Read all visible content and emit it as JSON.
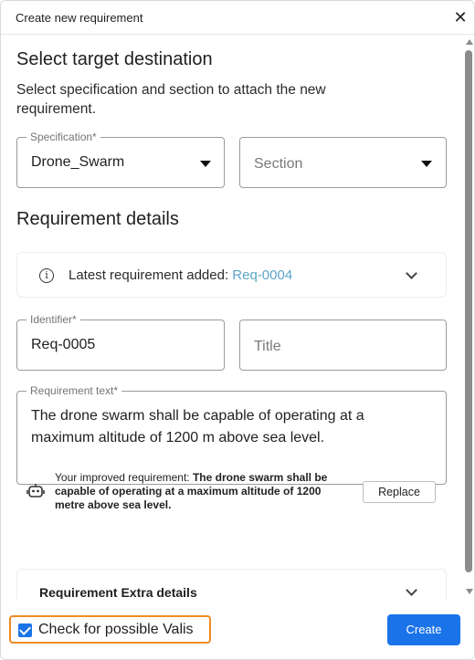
{
  "dialog": {
    "title": "Create new requirement",
    "close_glyph": "✕"
  },
  "target": {
    "heading": "Select target destination",
    "subtitle": "Select specification and section to attach the new requirement.",
    "specification": {
      "label": "Specification*",
      "value": "Drone_Swarm"
    },
    "section": {
      "placeholder": "Section"
    }
  },
  "details": {
    "heading": "Requirement details",
    "latest": {
      "label": "Latest requirement added: ",
      "link": "Req-0004"
    },
    "identifier": {
      "label": "Identifier*",
      "value": "Req-0005"
    },
    "title": {
      "placeholder": "Title"
    },
    "requirement_text": {
      "label": "Requirement text*",
      "value": "The drone swarm shall be capable of operating at a maximum altitude of 1200 m above sea level."
    },
    "improved": {
      "prefix": "Your improved requirement: ",
      "text": "The drone swarm shall be capable of operating at a maximum altitude of 1200 metre above sea level.",
      "replace_label": "Replace"
    },
    "extra": {
      "title": "Requirement Extra details"
    }
  },
  "footer": {
    "checkbox_label": "Check for possible Valis",
    "checkbox_checked": true,
    "create_label": "Create"
  },
  "colors": {
    "primary": "#1a73e8",
    "highlight_border": "#f08a24",
    "link": "#5aa5c8"
  },
  "icons": [
    "close-icon",
    "caret-down-icon",
    "info-icon",
    "chevron-down-icon",
    "robot-icon",
    "checkbox-checked-icon"
  ]
}
